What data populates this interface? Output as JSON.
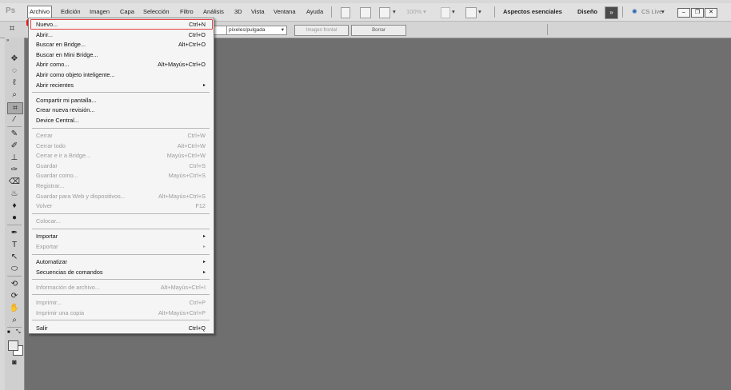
{
  "app": {
    "logo": "Ps"
  },
  "menubar": {
    "items": [
      "Archivo",
      "Edición",
      "Imagen",
      "Capa",
      "Selección",
      "Filtro",
      "Análisis",
      "3D",
      "Vista",
      "Ventana",
      "Ayuda"
    ],
    "zoom": "100%",
    "workspace_essentials": "Aspectos esenciales",
    "workspace_design": "Diseño",
    "cs_live": "CS Live"
  },
  "options_bar": {
    "resolution_unit": "píxeles/pulgada",
    "front_image_button": "Imagen frontal",
    "clear_button": "Borrar"
  },
  "file_menu": {
    "groups": [
      [
        {
          "label": "Nuevo...",
          "shortcut": "Ctrl+N",
          "enabled": true,
          "highlight": true
        },
        {
          "label": "Abrir...",
          "shortcut": "Ctrl+O",
          "enabled": true
        },
        {
          "label": "Buscar en Bridge...",
          "shortcut": "Alt+Ctrl+O",
          "enabled": true
        },
        {
          "label": "Buscar en Mini Bridge...",
          "shortcut": "",
          "enabled": true
        },
        {
          "label": "Abrir como...",
          "shortcut": "Alt+Mayús+Ctrl+O",
          "enabled": true
        },
        {
          "label": "Abrir como objeto inteligente...",
          "shortcut": "",
          "enabled": true
        },
        {
          "label": "Abrir recientes",
          "shortcut": "",
          "enabled": true,
          "submenu": true
        }
      ],
      [
        {
          "label": "Compartir mi pantalla...",
          "shortcut": "",
          "enabled": true
        },
        {
          "label": "Crear nueva revisión...",
          "shortcut": "",
          "enabled": true
        },
        {
          "label": "Device Central...",
          "shortcut": "",
          "enabled": true
        }
      ],
      [
        {
          "label": "Cerrar",
          "shortcut": "Ctrl+W",
          "enabled": false
        },
        {
          "label": "Cerrar todo",
          "shortcut": "Alt+Ctrl+W",
          "enabled": false
        },
        {
          "label": "Cerrar e ir a Bridge...",
          "shortcut": "Mayús+Ctrl+W",
          "enabled": false
        },
        {
          "label": "Guardar",
          "shortcut": "Ctrl+S",
          "enabled": false
        },
        {
          "label": "Guardar como...",
          "shortcut": "Mayús+Ctrl+S",
          "enabled": false
        },
        {
          "label": "Registrar...",
          "shortcut": "",
          "enabled": false
        },
        {
          "label": "Guardar para Web y dispositivos...",
          "shortcut": "Alt+Mayús+Ctrl+S",
          "enabled": false
        },
        {
          "label": "Volver",
          "shortcut": "F12",
          "enabled": false
        }
      ],
      [
        {
          "label": "Colocar...",
          "shortcut": "",
          "enabled": false
        }
      ],
      [
        {
          "label": "Importar",
          "shortcut": "",
          "enabled": true,
          "submenu": true
        },
        {
          "label": "Exportar",
          "shortcut": "",
          "enabled": false,
          "submenu": true
        }
      ],
      [
        {
          "label": "Automatizar",
          "shortcut": "",
          "enabled": true,
          "submenu": true
        },
        {
          "label": "Secuencias de comandos",
          "shortcut": "",
          "enabled": true,
          "submenu": true
        }
      ],
      [
        {
          "label": "Información de archivo...",
          "shortcut": "Alt+Mayús+Ctrl+I",
          "enabled": false
        }
      ],
      [
        {
          "label": "Imprimir...",
          "shortcut": "Ctrl+P",
          "enabled": false
        },
        {
          "label": "Imprimir una copia",
          "shortcut": "Alt+Mayús+Ctrl+P",
          "enabled": false
        }
      ],
      [
        {
          "label": "Salir",
          "shortcut": "Ctrl+Q",
          "enabled": true
        }
      ]
    ]
  },
  "tools": [
    "move-icon",
    "marquee-icon",
    "lasso-icon",
    "quick-select-icon",
    "crop-icon",
    "eyedropper-icon",
    "healing-brush-icon",
    "brush-icon",
    "clone-stamp-icon",
    "history-brush-icon",
    "eraser-icon",
    "paint-bucket-icon",
    "blur-icon",
    "dodge-icon",
    "pen-icon",
    "type-icon",
    "path-select-icon",
    "shape-icon",
    "3d-rotate-icon",
    "3d-orbit-icon",
    "hand-icon",
    "zoom-icon"
  ],
  "colors": {
    "workspace": "#6f6f6f",
    "highlight_border": "#e24040",
    "red_mark": "#e11a1a"
  }
}
